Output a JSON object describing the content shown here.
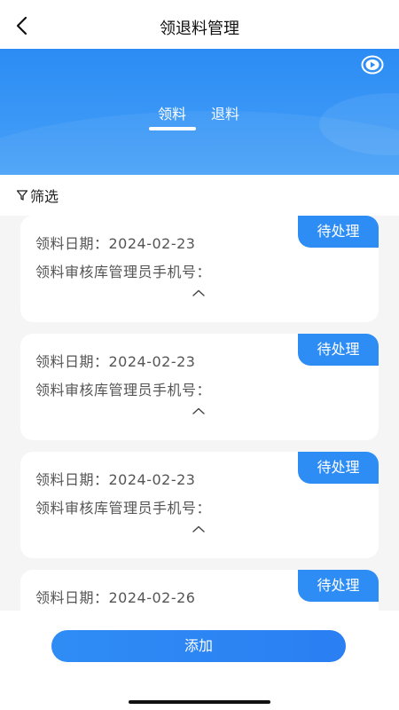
{
  "header": {
    "title": "领退料管理"
  },
  "tabs": [
    {
      "label": "领料",
      "active": true
    },
    {
      "label": "退料",
      "active": false
    }
  ],
  "filter": {
    "label": "筛选"
  },
  "cards": [
    {
      "status": "待处理",
      "date_line": "领料日期：2024-02-23",
      "phone_line": "领料审核库管理员手机号："
    },
    {
      "status": "待处理",
      "date_line": "领料日期：2024-02-23",
      "phone_line": "领料审核库管理员手机号："
    },
    {
      "status": "待处理",
      "date_line": "领料日期：2024-02-23",
      "phone_line": "领料审核库管理员手机号："
    },
    {
      "status": "待处理",
      "date_line": "领料日期：2024-02-26",
      "phone_line": ""
    }
  ],
  "footer": {
    "add_label": "添加"
  },
  "colors": {
    "primary": "#2e8df5",
    "background": "#f5f5f5"
  },
  "icons": {
    "back": "chevron-left-icon",
    "video": "play-circle-icon",
    "filter": "filter-icon",
    "collapse": "chevron-up-icon"
  }
}
